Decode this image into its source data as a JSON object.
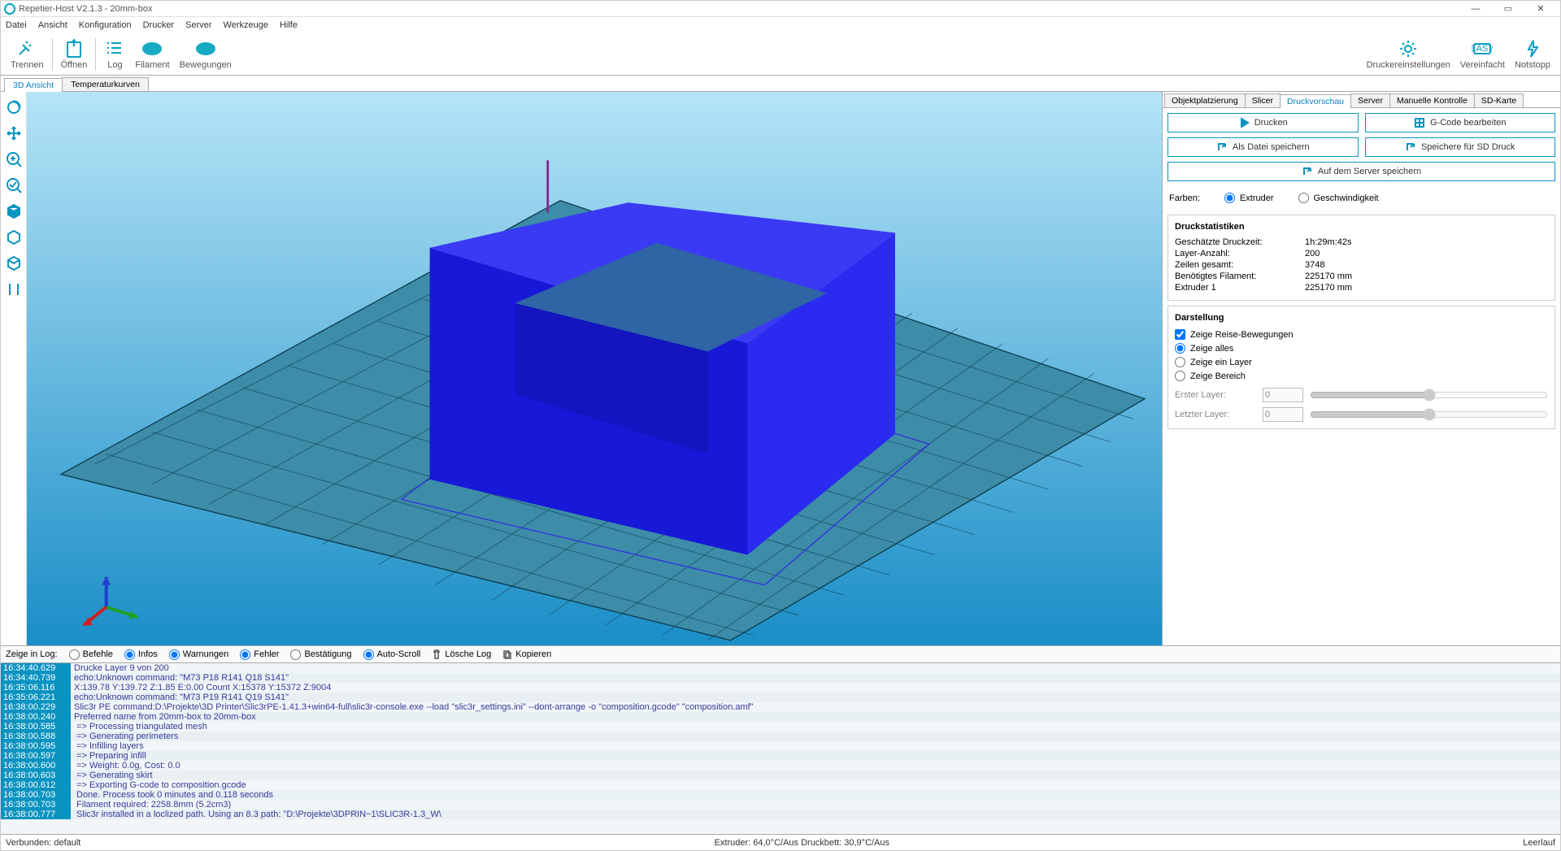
{
  "title": "Repetier-Host V2.1.3 - 20mm-box",
  "menu": [
    "Datei",
    "Ansicht",
    "Konfiguration",
    "Drucker",
    "Server",
    "Werkzeuge",
    "Hilfe"
  ],
  "toolbar": {
    "trennen": "Trennen",
    "oeffnen": "Öffnen",
    "log": "Log",
    "filament": "Filament",
    "bewegungen": "Bewegungen",
    "einst": "Druckereinstellungen",
    "vereinfacht": "Vereinfacht",
    "notstopp": "Notstopp"
  },
  "subtabs": {
    "a": "3D Ansicht",
    "b": "Temperaturkurven"
  },
  "rtabs": [
    "Objektplatzierung",
    "Slicer",
    "Druckvorschau",
    "Server",
    "Manuelle Kontrolle",
    "SD-Karte"
  ],
  "buttons": {
    "drucken": "Drucken",
    "gcode": "G-Code bearbeiten",
    "datei": "Als Datei speichern",
    "sd": "Speichere für SD Druck",
    "server": "Auf dem Server speichern"
  },
  "farben": {
    "label": "Farben:",
    "ext": "Extruder",
    "gesch": "Geschwindigkeit"
  },
  "stats": {
    "title": "Druckstatistiken",
    "rows": [
      [
        "Geschätzte Druckzeit:",
        "1h:29m:42s"
      ],
      [
        "Layer-Anzahl:",
        "200"
      ],
      [
        "Zeilen gesamt:",
        "3748"
      ],
      [
        "Benötigtes Filament:",
        "225170 mm"
      ],
      [
        "Extruder 1",
        "225170 mm"
      ]
    ]
  },
  "darst": {
    "title": "Darstellung",
    "reise": "Zeige Reise-Bewegungen",
    "alles": "Zeige alles",
    "ein": "Zeige ein Layer",
    "bereich": "Zeige Bereich",
    "erster": "Erster Layer:",
    "letzter": "Letzter Layer:",
    "v0": "0"
  },
  "logbar": {
    "label": "Zeige in Log:",
    "befehle": "Befehle",
    "infos": "Infos",
    "warn": "Warnungen",
    "fehler": "Fehler",
    "best": "Bestätigung",
    "auto": "Auto-Scroll",
    "del": "Lösche Log",
    "copy": "Kopieren"
  },
  "log": [
    [
      "16:34:40.629",
      "Drucke Layer 9 von 200"
    ],
    [
      "16:34:40.739",
      "echo:Unknown command: \"M73 P18 R141 Q18 S141\""
    ],
    [
      "16:35:06.116",
      "X:139.78 Y:139.72 Z:1.85 E:0.00 Count X:15378 Y:15372 Z:9004"
    ],
    [
      "16:35:06.221",
      "echo:Unknown command: \"M73 P19 R141 Q19 S141\""
    ],
    [
      "16:38:00.229",
      "Slic3r PE command:D:\\Projekte\\3D Printer\\Slic3rPE-1.41.3+win64-full\\slic3r-console.exe --load \"slic3r_settings.ini\" --dont-arrange -o \"composition.gcode\" \"composition.amf\""
    ],
    [
      "16:38:00.240",
      "Preferred name from 20mm-box to 20mm-box"
    ],
    [
      "16:38:00.585",
      "<Slic3rPE> => Processing triangulated mesh"
    ],
    [
      "16:38:00.588",
      "<Slic3rPE> => Generating perimeters"
    ],
    [
      "16:38:00.595",
      "<Slic3rPE> => Infilling layers"
    ],
    [
      "16:38:00.597",
      "<Slic3rPE> => Preparing infill"
    ],
    [
      "16:38:00.600",
      "<Slic3rPE> => Weight: 0.0g, Cost: 0.0"
    ],
    [
      "16:38:00.603",
      "<Slic3rPE> => Generating skirt"
    ],
    [
      "16:38:00.612",
      "<Slic3rPE> => Exporting G-code to composition.gcode"
    ],
    [
      "16:38:00.703",
      "<Slic3rPE> Done. Process took 0 minutes and 0.118 seconds"
    ],
    [
      "16:38:00.703",
      "<Slic3rPE> Filament required: 2258.8mm (5.2cm3)"
    ],
    [
      "16:38:00.777",
      "<Slic3rPE> Slic3r installed in a loclized path. Using an 8.3 path: \"D:\\Projekte\\3DPRIN~1\\SLIC3R-1.3_W\\"
    ]
  ],
  "status": {
    "left": "Verbunden: default",
    "center": "Extruder: 64,0°C/Aus Druckbett: 30,9°C/Aus",
    "right": "Leerlauf"
  }
}
